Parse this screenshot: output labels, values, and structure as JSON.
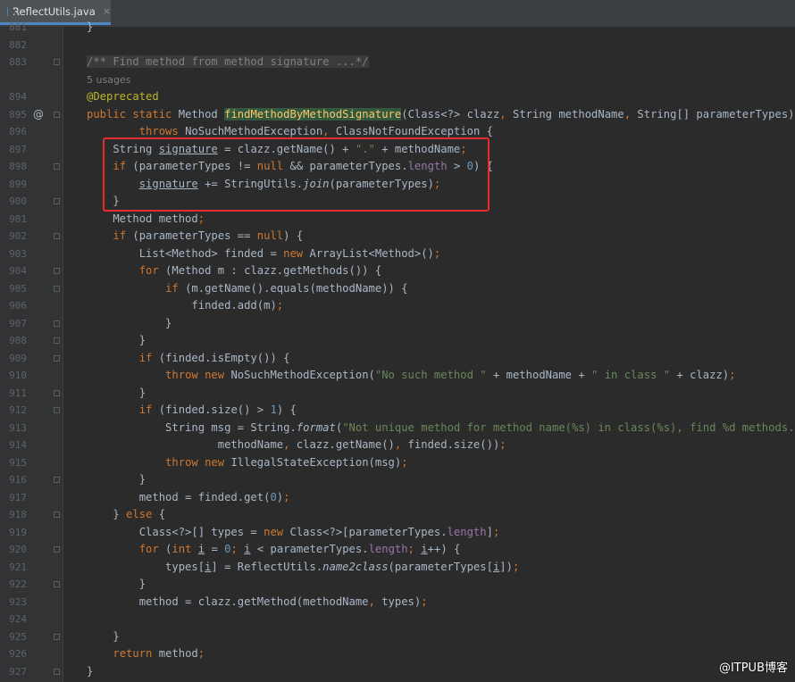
{
  "tab": {
    "icon": "class-icon",
    "filename": "ReflectUtils.java",
    "close": "×"
  },
  "lines": [
    {
      "n": "881",
      "code": "}"
    },
    {
      "n": "882",
      "code": ""
    },
    {
      "n": "883",
      "code": "/** Find method from method signature ...*/"
    },
    {
      "n": "",
      "code": "5 usages"
    },
    {
      "n": "894",
      "code": "@Deprecated"
    },
    {
      "n": "895",
      "code": "public static Method findMethodByMethodSignature(Class<?> clazz, String methodName, String[] parameterTypes)",
      "annot": "@"
    },
    {
      "n": "896",
      "code": "        throws NoSuchMethodException, ClassNotFoundException {"
    },
    {
      "n": "897",
      "code": "    String signature = clazz.getName() + \".\" + methodName;"
    },
    {
      "n": "898",
      "code": "    if (parameterTypes != null && parameterTypes.length > 0) {"
    },
    {
      "n": "899",
      "code": "        signature += StringUtils.join(parameterTypes);"
    },
    {
      "n": "900",
      "code": "    }"
    },
    {
      "n": "901",
      "code": "    Method method;"
    },
    {
      "n": "902",
      "code": "    if (parameterTypes == null) {"
    },
    {
      "n": "903",
      "code": "        List<Method> finded = new ArrayList<Method>();"
    },
    {
      "n": "904",
      "code": "        for (Method m : clazz.getMethods()) {"
    },
    {
      "n": "905",
      "code": "            if (m.getName().equals(methodName)) {"
    },
    {
      "n": "906",
      "code": "                finded.add(m);"
    },
    {
      "n": "907",
      "code": "            }"
    },
    {
      "n": "908",
      "code": "        }"
    },
    {
      "n": "909",
      "code": "        if (finded.isEmpty()) {"
    },
    {
      "n": "910",
      "code": "            throw new NoSuchMethodException(\"No such method \" + methodName + \" in class \" + clazz);"
    },
    {
      "n": "911",
      "code": "        }"
    },
    {
      "n": "912",
      "code": "        if (finded.size() > 1) {"
    },
    {
      "n": "913",
      "code": "            String msg = String.format(\"Not unique method for method name(%s) in class(%s), find %d methods.\","
    },
    {
      "n": "914",
      "code": "                    methodName, clazz.getName(), finded.size());"
    },
    {
      "n": "915",
      "code": "            throw new IllegalStateException(msg);"
    },
    {
      "n": "916",
      "code": "        }"
    },
    {
      "n": "917",
      "code": "        method = finded.get(0);"
    },
    {
      "n": "918",
      "code": "    } else {"
    },
    {
      "n": "919",
      "code": "        Class<?>[] types = new Class<?>[parameterTypes.length];"
    },
    {
      "n": "920",
      "code": "        for (int i = 0; i < parameterTypes.length; i++) {"
    },
    {
      "n": "921",
      "code": "            types[i] = ReflectUtils.name2class(parameterTypes[i]);"
    },
    {
      "n": "922",
      "code": "        }"
    },
    {
      "n": "923",
      "code": "        method = clazz.getMethod(methodName, types);"
    },
    {
      "n": "924",
      "code": ""
    },
    {
      "n": "925",
      "code": "    }"
    },
    {
      "n": "926",
      "code": "    return method;"
    },
    {
      "n": "927",
      "code": "}"
    }
  ],
  "watermark": "@ITPUB博客",
  "colors": {
    "keyword": "#cc7832",
    "string": "#6a8759",
    "number": "#6897bb",
    "comment": "#808080",
    "annotation": "#bbb529",
    "field": "#9876aa",
    "method_highlight": "#ffc66d",
    "highlight_box": "#e52b2b"
  }
}
